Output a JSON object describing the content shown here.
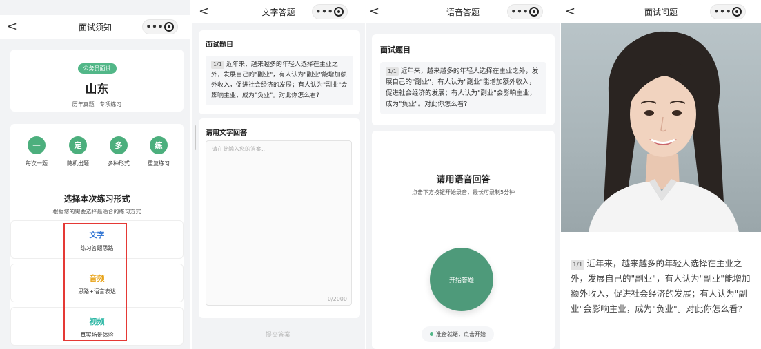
{
  "panel1": {
    "title": "面试须知",
    "back": "<",
    "badge": "公务员面试",
    "province": "山东",
    "subtitle": "历年真题 · 专项练习",
    "features": [
      {
        "icon": "一",
        "label": "每次一题"
      },
      {
        "icon": "定",
        "label": "随机出题"
      },
      {
        "icon": "多",
        "label": "多种形式"
      },
      {
        "icon": "练",
        "label": "重复练习"
      }
    ],
    "choose_title": "选择本次练习形式",
    "choose_sub": "根据您的需要选择最适合的练习方式",
    "options": [
      {
        "title": "文字",
        "desc": "练习答题思路",
        "color": "#3a7bd5"
      },
      {
        "title": "音频",
        "desc": "思路+语言表达",
        "color": "#e8a317"
      },
      {
        "title": "视频",
        "desc": "真实场景体验",
        "color": "#2fb8a6"
      }
    ]
  },
  "panel2": {
    "title": "文字答题",
    "back": "<",
    "question_header": "面试题目",
    "num": "1/1",
    "question": "近年来，越来越多的年轻人选择在主业之外，发展自己的\"副业\"，有人认为\"副业\"能增加额外收入，促进社会经济的发展；有人认为\"副业\"会影响主业，成为\"负业\"。对此你怎么看?",
    "answer_header": "请用文字回答",
    "placeholder": "请在此输入您的答案...",
    "counter": "0/2000",
    "submit": "提交答案"
  },
  "panel3": {
    "title": "语音答题",
    "back": "<",
    "question_header": "面试题目",
    "num": "1/1",
    "question": "近年来，越来越多的年轻人选择在主业之外，发展自己的\"副业\"，有人认为\"副业\"能增加额外收入，促进社会经济的发展；有人认为\"副业\"会影响主业，成为\"负业\"。对此你怎么看?",
    "voice_title": "请用语音回答",
    "voice_sub": "点击下方按钮开始录音，最长可录制5分钟",
    "start": "开始答题",
    "ready": "准备就绪，点击开始"
  },
  "panel4": {
    "title": "面试问题",
    "back": "<",
    "num": "1/1",
    "question": "近年来，越来越多的年轻人选择在主业之外，发展自己的\"副业\"，有人认为\"副业\"能增加额外收入，促进社会经济的发展；有人认为\"副业\"会影响主业，成为\"负业\"。对此你怎么看?"
  },
  "capsule": {
    "more": "•••"
  }
}
